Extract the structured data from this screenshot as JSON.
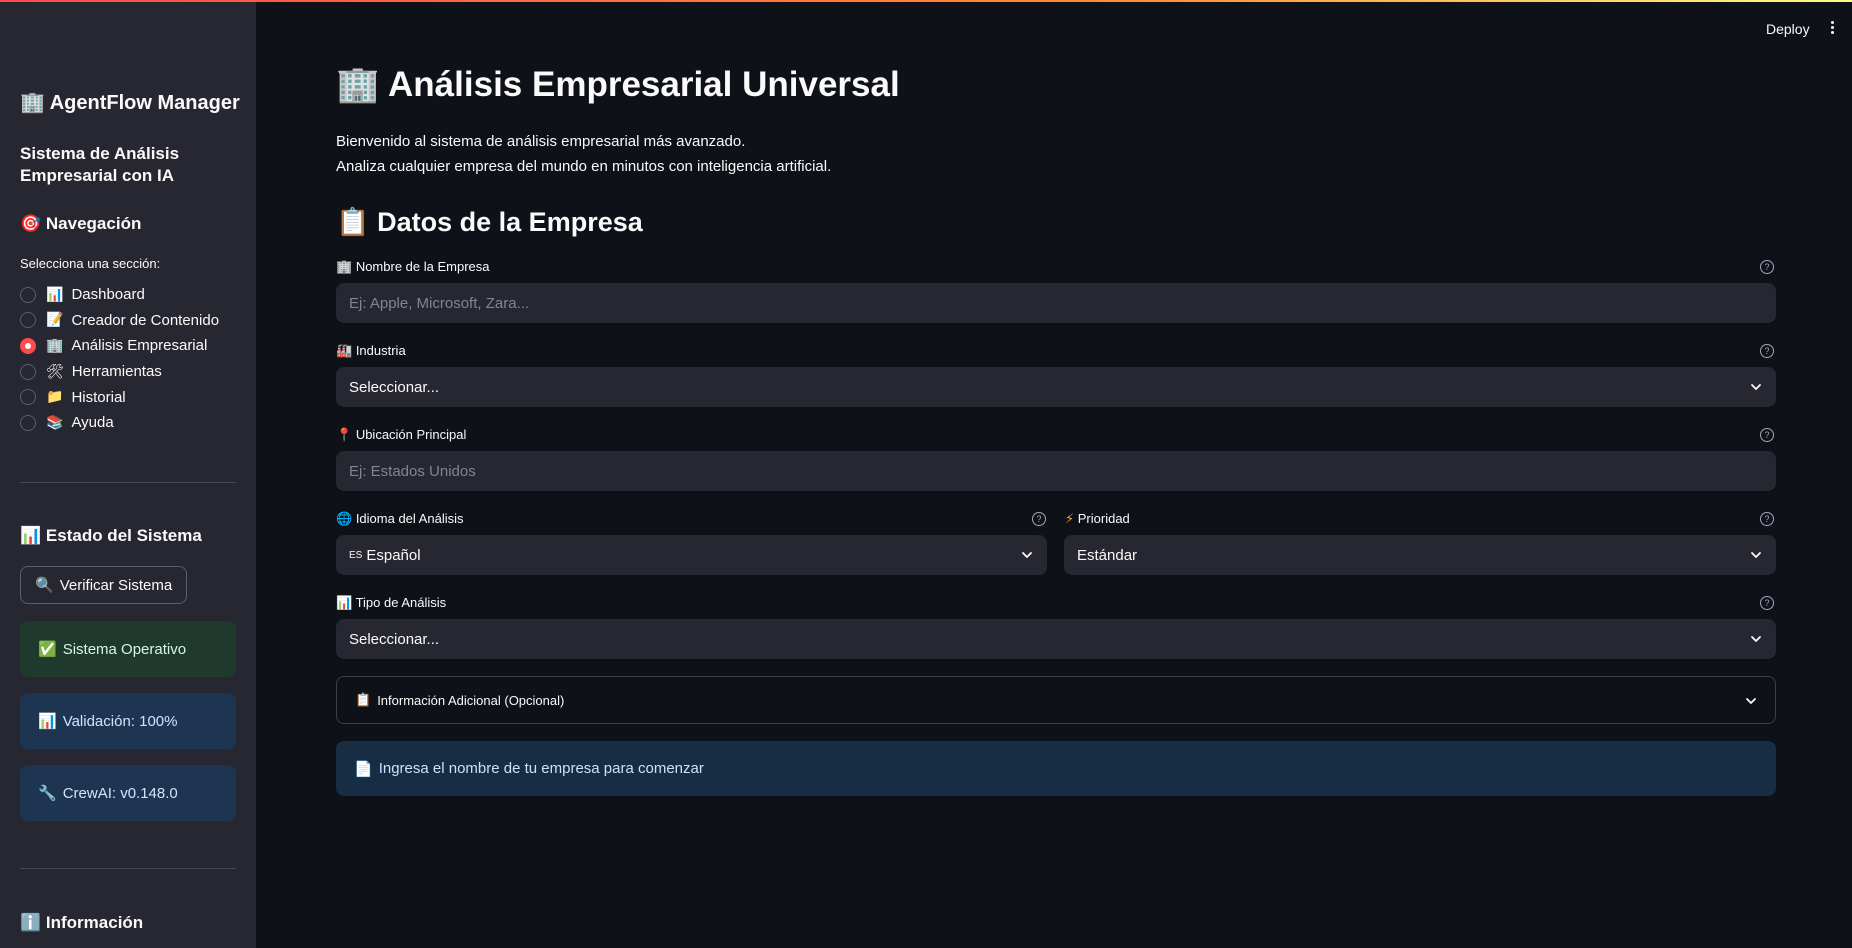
{
  "colors": {
    "accent": "#ff4b4b",
    "background": "#0e1117",
    "sidebar": "#262730",
    "success_bg": "#1f3a2d",
    "info_bg": "#1d3550"
  },
  "header": {
    "deploy_label": "Deploy",
    "menu_icon": "kebab-menu-icon"
  },
  "sidebar": {
    "title_icon": "🏢",
    "title": "AgentFlow Manager",
    "subtitle": "Sistema de Análisis Empresarial con IA",
    "nav_icon": "🎯",
    "nav_heading": "Navegación",
    "nav_label": "Selecciona una sección:",
    "nav_items": [
      {
        "icon": "📊",
        "label": "Dashboard",
        "selected": false
      },
      {
        "icon": "📝",
        "label": "Creador de Contenido",
        "selected": false
      },
      {
        "icon": "🏢",
        "label": "Análisis Empresarial",
        "selected": true
      },
      {
        "icon": "🛠",
        "label": "Herramientas",
        "selected": false
      },
      {
        "icon": "📁",
        "label": "Historial",
        "selected": false
      },
      {
        "icon": "📚",
        "label": "Ayuda",
        "selected": false
      }
    ],
    "status_icon": "📊",
    "status_heading": "Estado del Sistema",
    "verify_icon": "🔍",
    "verify_button": "Verificar Sistema",
    "alerts": [
      {
        "icon": "✅",
        "text": "Sistema Operativo",
        "kind": "success"
      },
      {
        "icon": "📊",
        "text": "Validación: 100%",
        "kind": "info"
      },
      {
        "icon": "🔧",
        "text": "CrewAI: v0.148.0",
        "kind": "info"
      }
    ],
    "info_icon": "ℹ️",
    "info_heading": "Información"
  },
  "main": {
    "title_icon": "🏢",
    "title": "Análisis Empresarial Universal",
    "intro_line1": "Bienvenido al sistema de análisis empresarial más avanzado.",
    "intro_line2": "Analiza cualquier empresa del mundo en minutos con inteligencia artificial.",
    "section_icon": "📋",
    "section_title": "Datos de la Empresa",
    "fields": {
      "company": {
        "icon": "🏢",
        "label": "Nombre de la Empresa",
        "value": "",
        "placeholder": "Ej: Apple, Microsoft, Zara..."
      },
      "industry": {
        "icon": "🏭",
        "label": "Industria",
        "value": "Seleccionar..."
      },
      "location": {
        "icon": "📍",
        "label": "Ubicación Principal",
        "value": "",
        "placeholder": "Ej: Estados Unidos"
      },
      "language": {
        "icon": "🌐",
        "label": "Idioma del Análisis",
        "flag": "ES",
        "value": "Español"
      },
      "priority": {
        "icon": "⚡",
        "label": "Prioridad",
        "value": "Estándar"
      },
      "analysis_type": {
        "icon": "📊",
        "label": "Tipo de Análisis",
        "value": "Seleccionar..."
      }
    },
    "expander": {
      "icon": "📋",
      "label": "Información Adicional (Opcional)"
    },
    "banner": {
      "icon": "📄",
      "text": "Ingresa el nombre de tu empresa para comenzar"
    },
    "help_glyph": "?"
  }
}
